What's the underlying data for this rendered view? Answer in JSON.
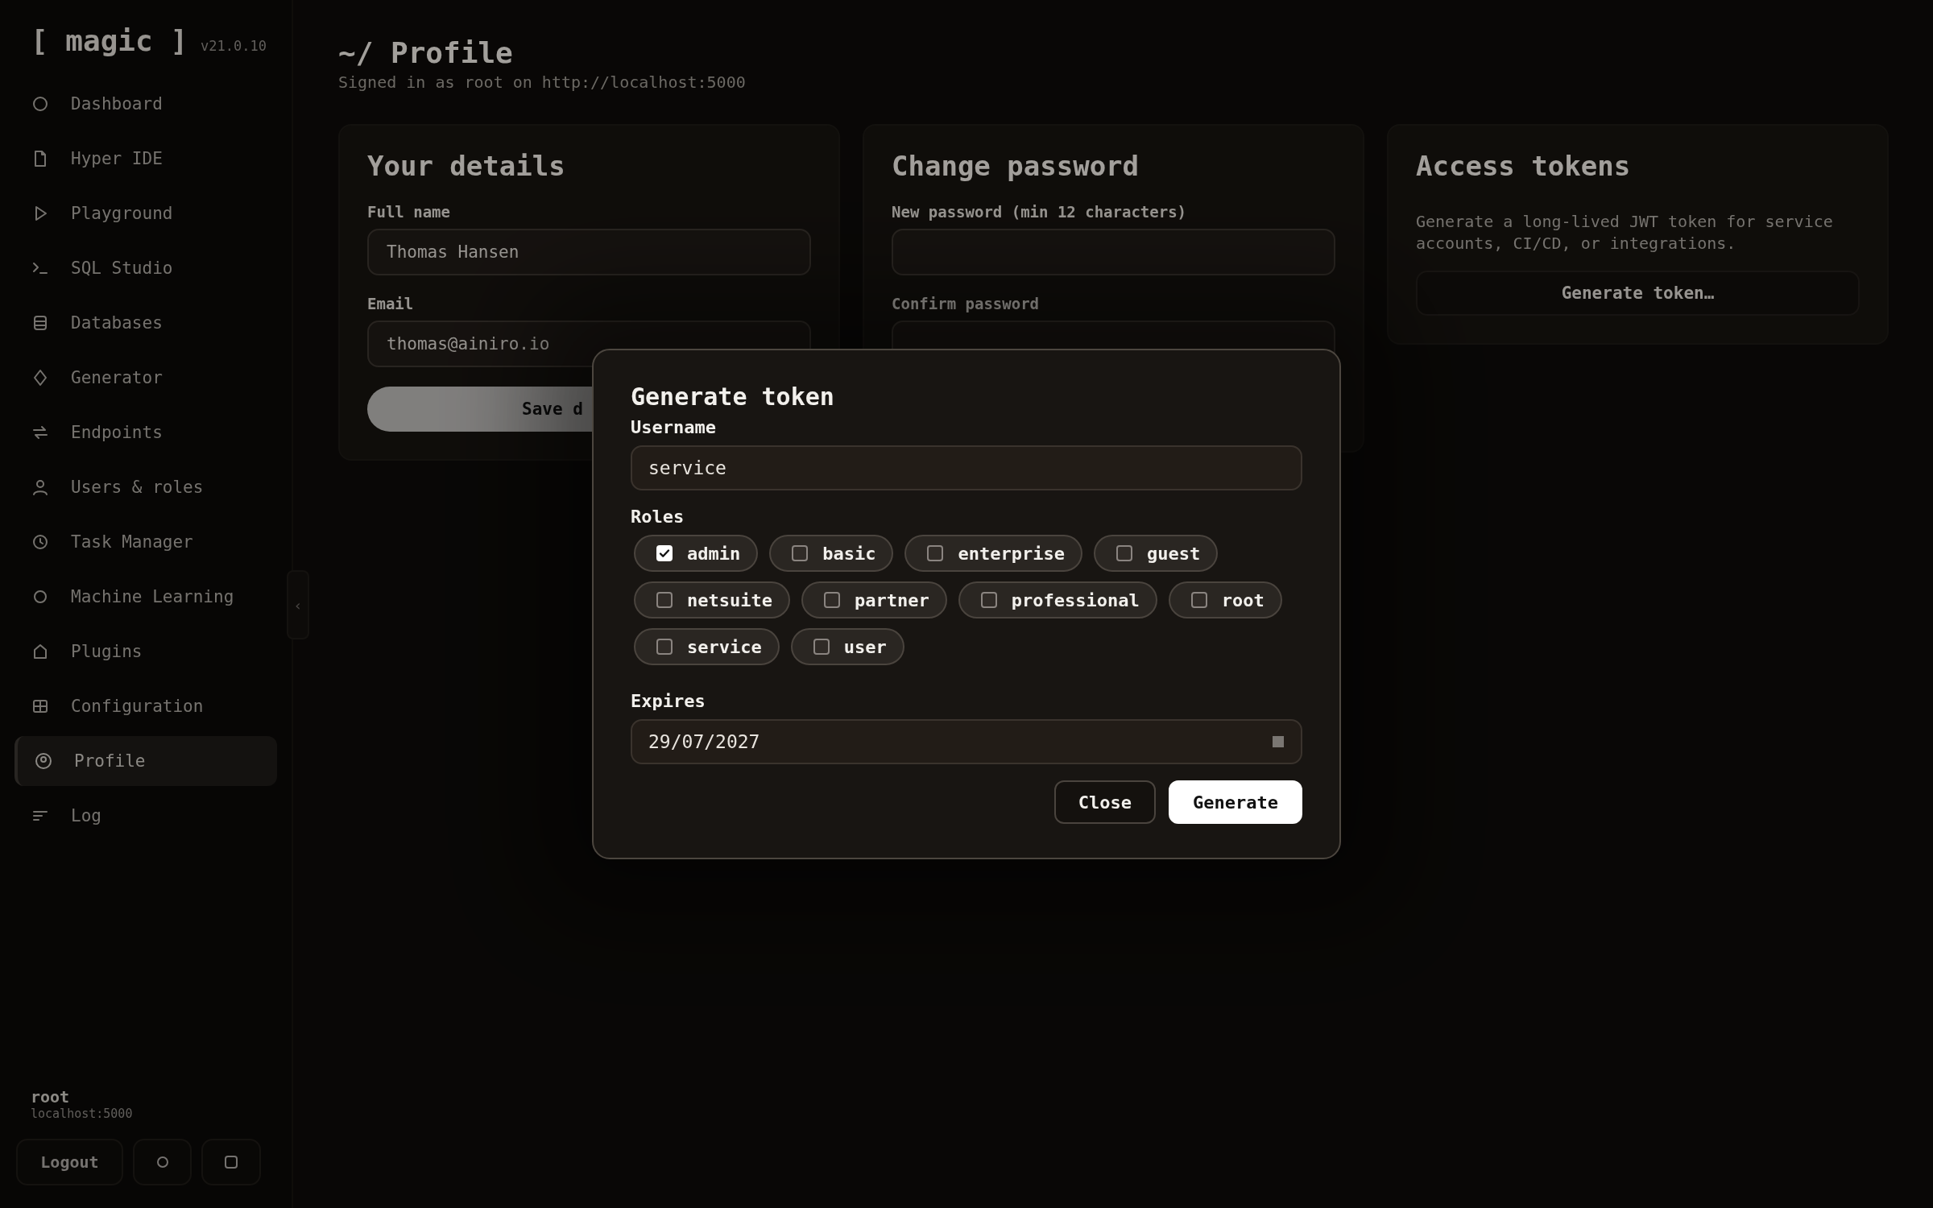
{
  "sidebar": {
    "logo": "[ magic ]",
    "version": "v21.0.10",
    "items": [
      {
        "label": "Dashboard",
        "selected": false
      },
      {
        "label": "Hyper IDE",
        "selected": false
      },
      {
        "label": "Playground",
        "selected": false
      },
      {
        "label": "SQL Studio",
        "selected": false
      },
      {
        "label": "Databases",
        "selected": false
      },
      {
        "label": "Generator",
        "selected": false
      },
      {
        "label": "Endpoints",
        "selected": false
      },
      {
        "label": "Users & roles",
        "selected": false
      },
      {
        "label": "Task Manager",
        "selected": false
      },
      {
        "label": "Machine Learning",
        "selected": false
      },
      {
        "label": "Plugins",
        "selected": false
      },
      {
        "label": "Configuration",
        "selected": false
      },
      {
        "label": "Profile",
        "selected": true
      },
      {
        "label": "Log",
        "selected": false
      }
    ],
    "collapse": "‹",
    "user": {
      "name": "root",
      "host": "localhost:5000"
    },
    "logout": "Logout"
  },
  "main": {
    "title": "~/ Profile",
    "subtitle": "Signed in as root on http://localhost:5000",
    "cards": [
      {
        "heading": "Your details",
        "fields": [
          {
            "label": "Full name",
            "value": "Thomas Hansen"
          },
          {
            "label": "Email",
            "value": "thomas@ainiro.io"
          }
        ],
        "button": {
          "label": "Save d",
          "primary": true
        }
      },
      {
        "heading": "Change password",
        "fields": [
          {
            "label": "New password (min 12 characters)"
          },
          {
            "label": "Confirm password"
          }
        ]
      },
      {
        "heading": "Access tokens",
        "description": "Generate a long-lived JWT token for service accounts, CI/CD, or integrations.",
        "button": {
          "label": "Generate token…",
          "primary": false
        }
      }
    ]
  },
  "modal": {
    "title": "Generate token",
    "username": {
      "label": "Username",
      "value": "service"
    },
    "roles": {
      "label": "Roles",
      "items": [
        {
          "label": "admin",
          "checked": true
        },
        {
          "label": "basic",
          "checked": false
        },
        {
          "label": "enterprise",
          "checked": false
        },
        {
          "label": "guest",
          "checked": false
        },
        {
          "label": "netsuite",
          "checked": false
        },
        {
          "label": "partner",
          "checked": false
        },
        {
          "label": "professional",
          "checked": false
        },
        {
          "label": "root",
          "checked": false
        },
        {
          "label": "service",
          "checked": false
        },
        {
          "label": "user",
          "checked": false
        }
      ]
    },
    "expires": {
      "label": "Expires",
      "value": "29/07/2027"
    },
    "buttons": [
      {
        "label": "Close",
        "primary": false
      },
      {
        "label": "Generate",
        "primary": true
      }
    ]
  }
}
